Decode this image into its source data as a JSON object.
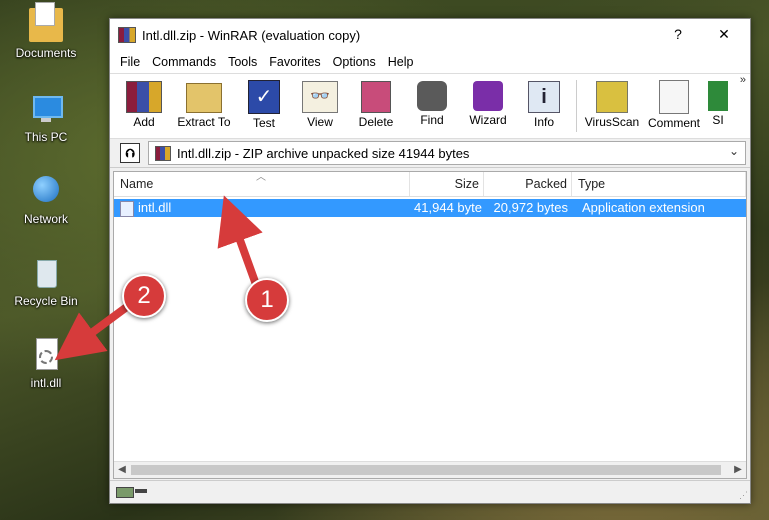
{
  "desktop": {
    "icons": [
      {
        "label": "Documents"
      },
      {
        "label": "This PC"
      },
      {
        "label": "Network"
      },
      {
        "label": "Recycle Bin"
      },
      {
        "label": "intl.dll"
      }
    ]
  },
  "window": {
    "title": "Intl.dll.zip - WinRAR (evaluation copy)",
    "help_button": "?",
    "close_button": "✕"
  },
  "menu": [
    "File",
    "Commands",
    "Tools",
    "Favorites",
    "Options",
    "Help"
  ],
  "toolbar": {
    "buttons": [
      "Add",
      "Extract To",
      "Test",
      "View",
      "Delete",
      "Find",
      "Wizard",
      "Info",
      "VirusScan",
      "Comment",
      "SI"
    ],
    "overflow": "»"
  },
  "address": {
    "up_label": "⮉",
    "path": "Intl.dll.zip - ZIP archive unpacked size 41944 bytes",
    "dropdown": "⌄"
  },
  "columns": {
    "name": "Name",
    "size": "Size",
    "packed": "Packed",
    "type": "Type"
  },
  "files": [
    {
      "name": "intl.dll",
      "size": "41,944 byte",
      "packed": "20,972 bytes",
      "type": "Application extension"
    }
  ],
  "annotations": {
    "badge1": "1",
    "badge2": "2"
  },
  "colors": {
    "selection": "#3399ff",
    "badge": "#d63b3b"
  }
}
